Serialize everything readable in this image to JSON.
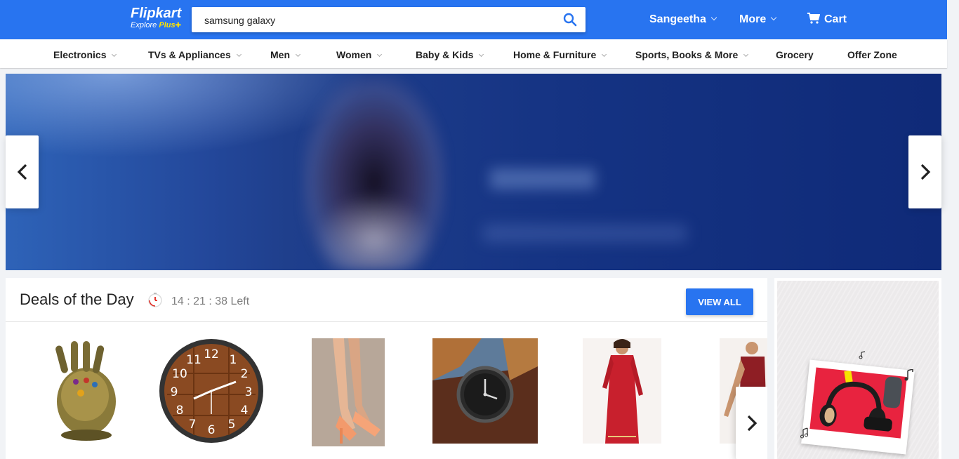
{
  "header": {
    "logo_main": "Flipkart",
    "logo_sub_prefix": "Explore",
    "logo_sub_plus": "Plus",
    "search_value": "samsung galaxy",
    "user_label": "Sangeetha",
    "more_label": "More",
    "cart_label": "Cart",
    "brand_color": "#2874f0"
  },
  "categories": [
    {
      "label": "Electronics",
      "dropdown": true
    },
    {
      "label": "TVs & Appliances",
      "dropdown": true
    },
    {
      "label": "Men",
      "dropdown": true
    },
    {
      "label": "Women",
      "dropdown": true
    },
    {
      "label": "Baby & Kids",
      "dropdown": true
    },
    {
      "label": "Home & Furniture",
      "dropdown": true
    },
    {
      "label": "Sports, Books & More",
      "dropdown": true
    },
    {
      "label": "Grocery",
      "dropdown": false
    },
    {
      "label": "Offer Zone",
      "dropdown": false
    }
  ],
  "banner": {
    "prev_icon": "chevron-left-icon",
    "next_icon": "chevron-right-icon"
  },
  "deals": {
    "title": "Deals of the Day",
    "timer": "14 : 21 : 38 Left",
    "timer_icon": "stopwatch-icon",
    "view_all_label": "VIEW ALL",
    "products": [
      {
        "image": "gauntlet-figure"
      },
      {
        "image": "wooden-wall-clock"
      },
      {
        "image": "peach-heels"
      },
      {
        "image": "wrist-watch"
      },
      {
        "image": "red-kurta"
      },
      {
        "image": "red-dress"
      }
    ]
  },
  "side_ad": {
    "image": "headphones-speaker-collage"
  }
}
